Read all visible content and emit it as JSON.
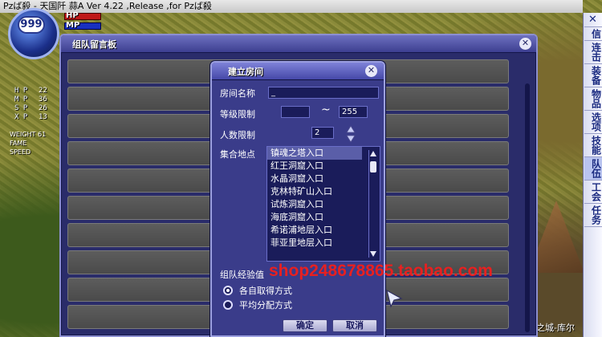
{
  "window": {
    "title": "Pzば殺 -    天国阡    蒜A Ver 4.22 ,Release ,for Pzば殺"
  },
  "hud": {
    "level": "999",
    "hp_label": "HP",
    "mp_label": "MP",
    "stats": [
      {
        "key": "H P",
        "value": "22"
      },
      {
        "key": "M P",
        "value": "36"
      },
      {
        "key": "S P",
        "value": "26"
      },
      {
        "key": "X P",
        "value": "13"
      }
    ],
    "weight_label": "WEIGHT",
    "weight_value": "61",
    "fame_label": "FAME",
    "speed_label": "SPEED"
  },
  "side_menu": {
    "close": "✕",
    "items": [
      "信",
      "连击",
      "装备",
      "物品",
      "选项",
      "技能",
      "队伍",
      "工会",
      "任务"
    ]
  },
  "map_label": "之城-库尔",
  "board": {
    "title": "组队留言板",
    "close": "✕"
  },
  "dialog": {
    "title": "建立房间",
    "close": "✕",
    "room_name_label": "房间名称",
    "room_name_value": "_",
    "level_limit_label": "等级限制",
    "level_min": "",
    "level_tilde": "~",
    "level_max": "255",
    "people_limit_label": "人数限制",
    "people_value": "2",
    "meeting_point_label": "集合地点",
    "locations": [
      "镇魂之塔入口",
      "红王洞窟入口",
      "水晶洞窟入口",
      "克林特矿山入口",
      "试炼洞窟入口",
      "海底洞窟入口",
      "希诺浦地层入口",
      "菲亚里地层入口"
    ],
    "exp_label": "组队经验值",
    "exp_options": [
      "各自取得方式",
      "平均分配方式"
    ],
    "ok_label": "确定",
    "cancel_label": "取消"
  },
  "watermark": "shop248678865.taobao.com"
}
